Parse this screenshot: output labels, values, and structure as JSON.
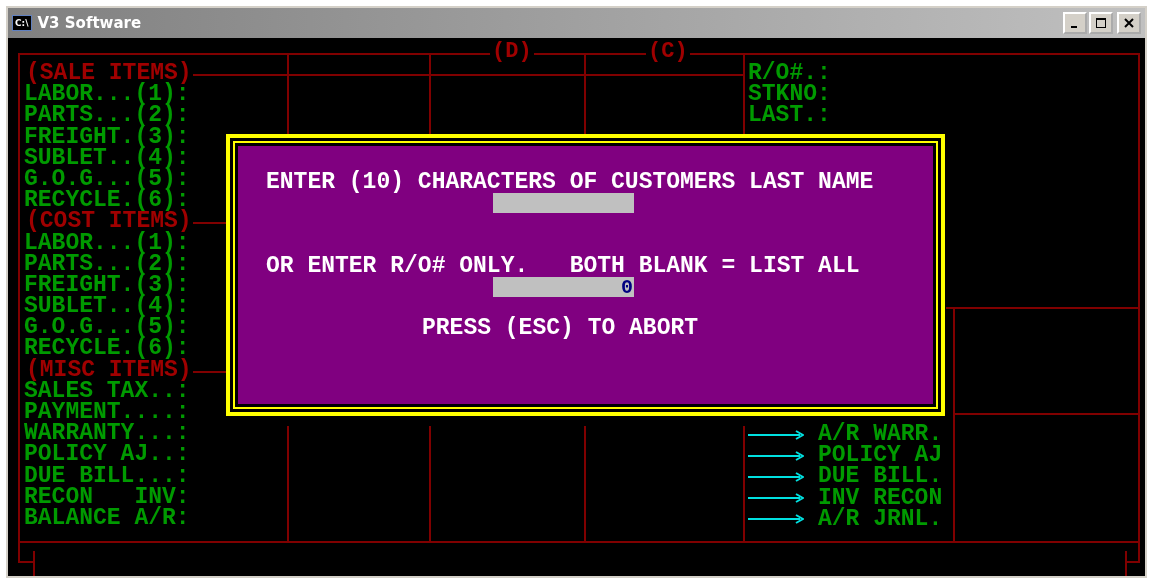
{
  "window": {
    "icon_text": "C:\\",
    "title": "V3 Software"
  },
  "column_markers": [
    "(D)",
    "(C)"
  ],
  "left_panel": {
    "sections": [
      {
        "heading": "(SALE ITEMS)",
        "items": [
          "LABOR...(1):",
          "PARTS...(2):",
          "FREIGHT.(3):",
          "SUBLET..(4):",
          "G.O.G...(5):",
          "RECYCLE.(6):"
        ]
      },
      {
        "heading": "(COST ITEMS)",
        "items": [
          "LABOR...(1):",
          "PARTS...(2):",
          "FREIGHT.(3):",
          "SUBLET..(4):",
          "G.O.G...(5):",
          "RECYCLE.(6):"
        ]
      },
      {
        "heading": "(MISC ITEMS)",
        "items": [
          "SALES TAX..:",
          "PAYMENT....:",
          "WARRANTY...:",
          "POLICY AJ..:",
          "DUE BILL...:",
          "RECON   INV:",
          "BALANCE A/R:"
        ]
      }
    ]
  },
  "right_panel": {
    "fields": [
      "R/O#.:",
      "STKNO:",
      "LAST.:"
    ]
  },
  "postings": [
    "A/R WARR.",
    "POLICY AJ",
    "DUE BILL.",
    "INV RECON",
    "A/R JRNL."
  ],
  "dialog": {
    "prompt": "ENTER (10) CHARACTERS OF CUSTOMERS LAST NAME",
    "alt_prompt": "OR ENTER R/O# ONLY.   BOTH BLANK = LIST ALL",
    "ro_number_field": {
      "value": "0"
    },
    "abort_hint": "PRESS (ESC) TO ABORT"
  }
}
